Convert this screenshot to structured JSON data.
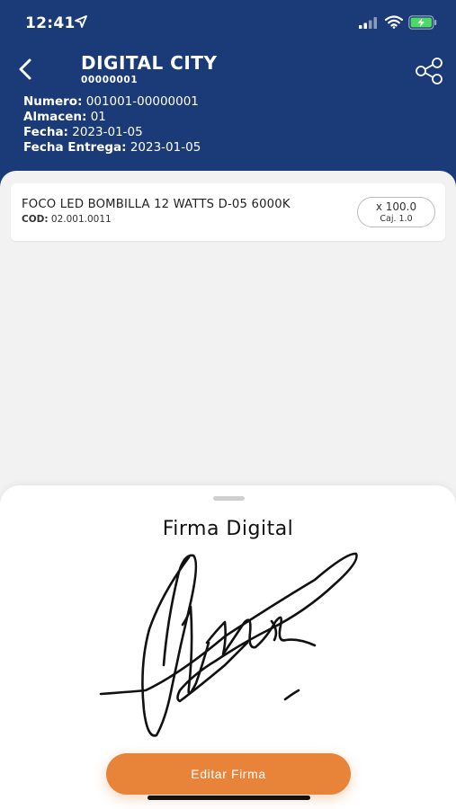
{
  "status_bar": {
    "time": "12:41",
    "icons": [
      "location-arrow-icon",
      "cellular-signal-icon",
      "wifi-icon",
      "battery-charging-icon"
    ]
  },
  "header": {
    "company_name": "DIGITAL CITY",
    "company_code": "00000001",
    "background_color": "#1b3b78",
    "fields": [
      {
        "label": "Numero:",
        "value": "001001-00000001"
      },
      {
        "label": "Almacen:",
        "value": "01"
      },
      {
        "label": "Fecha:",
        "value": "2023-01-05"
      },
      {
        "label": "Fecha Entrega:",
        "value": "2023-01-05"
      }
    ]
  },
  "items": [
    {
      "name": "FOCO  LED BOMBILLA 12 WATTS D-05 6000K",
      "code_label": "COD:",
      "code": "02.001.0011",
      "quantity": "x 100.0",
      "unit": "Caj. 1.0"
    }
  ],
  "signature_sheet": {
    "title": "Firma Digital",
    "edit_button": "Editar Firma",
    "accent_color": "#e8843a"
  }
}
